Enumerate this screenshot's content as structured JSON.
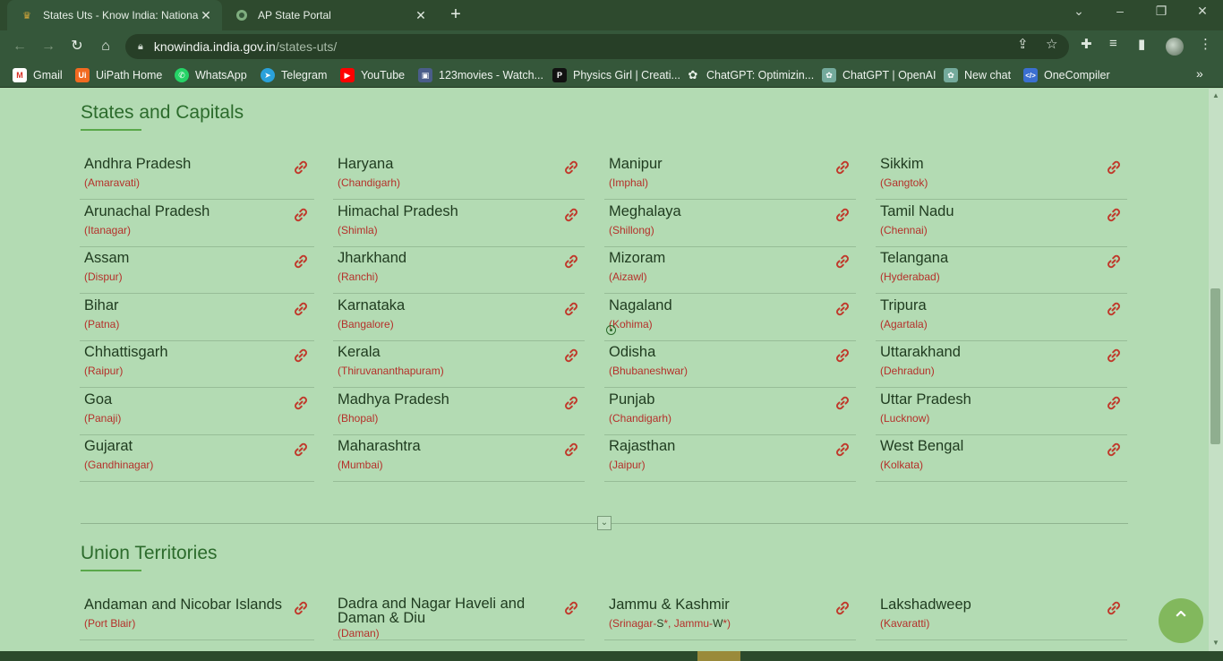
{
  "browser": {
    "tabs": [
      {
        "title": "States Uts - Know India: National",
        "active": true
      },
      {
        "title": "AP State Portal",
        "active": false
      }
    ],
    "new_tab": "+",
    "url_host": "knowindia.india.gov.in",
    "url_path": "/states-uts/",
    "bookmarks": [
      {
        "label": "Gmail",
        "icon": "gmail-icon"
      },
      {
        "label": "UiPath Home",
        "icon": "uipath-icon"
      },
      {
        "label": "WhatsApp",
        "icon": "whatsapp-icon"
      },
      {
        "label": "Telegram",
        "icon": "telegram-icon"
      },
      {
        "label": "YouTube",
        "icon": "youtube-icon"
      },
      {
        "label": "123movies - Watch...",
        "icon": "movies-icon"
      },
      {
        "label": "Physics Girl | Creati...",
        "icon": "patreon-icon"
      },
      {
        "label": "ChatGPT: Optimizin...",
        "icon": "openai-icon"
      },
      {
        "label": "ChatGPT | OpenAI",
        "icon": "openai-icon"
      },
      {
        "label": "New chat",
        "icon": "openai-icon"
      },
      {
        "label": "OneCompiler",
        "icon": "code-icon"
      }
    ]
  },
  "states": {
    "title": "States and Capitals",
    "columns": [
      [
        {
          "name": "Andhra Pradesh",
          "capital": "(Amaravati)"
        },
        {
          "name": "Arunachal Pradesh",
          "capital": "(Itanagar)"
        },
        {
          "name": "Assam",
          "capital": "(Dispur)"
        },
        {
          "name": "Bihar",
          "capital": "(Patna)"
        },
        {
          "name": "Chhattisgarh",
          "capital": "(Raipur)"
        },
        {
          "name": "Goa",
          "capital": "(Panaji)"
        },
        {
          "name": "Gujarat",
          "capital": "(Gandhinagar)"
        }
      ],
      [
        {
          "name": "Haryana",
          "capital": "(Chandigarh)"
        },
        {
          "name": "Himachal Pradesh",
          "capital": "(Shimla)"
        },
        {
          "name": "Jharkhand",
          "capital": "(Ranchi)"
        },
        {
          "name": "Karnataka",
          "capital": "(Bangalore)"
        },
        {
          "name": "Kerala",
          "capital": "(Thiruvananthapuram)"
        },
        {
          "name": "Madhya Pradesh",
          "capital": "(Bhopal)"
        },
        {
          "name": "Maharashtra",
          "capital": "(Mumbai)"
        }
      ],
      [
        {
          "name": "Manipur",
          "capital": "(Imphal)"
        },
        {
          "name": "Meghalaya",
          "capital": "(Shillong)"
        },
        {
          "name": "Mizoram",
          "capital": "(Aizawl)"
        },
        {
          "name": "Nagaland",
          "capital": "(Kohima)"
        },
        {
          "name": "Odisha",
          "capital": "(Bhubaneshwar)"
        },
        {
          "name": "Punjab",
          "capital": "(Chandigarh)"
        },
        {
          "name": "Rajasthan",
          "capital": "(Jaipur)"
        }
      ],
      [
        {
          "name": "Sikkim",
          "capital": "(Gangtok)"
        },
        {
          "name": "Tamil Nadu",
          "capital": "(Chennai)"
        },
        {
          "name": "Telangana",
          "capital": "(Hyderabad)"
        },
        {
          "name": "Tripura",
          "capital": "(Agartala)"
        },
        {
          "name": "Uttarakhand",
          "capital": "(Dehradun)"
        },
        {
          "name": "Uttar Pradesh",
          "capital": "(Lucknow)"
        },
        {
          "name": "West Bengal",
          "capital": "(Kolkata)"
        }
      ]
    ]
  },
  "uts": {
    "title": "Union Territories",
    "items": [
      {
        "name": "Andaman and Nicobar Islands",
        "capital": "(Port Blair)"
      },
      {
        "name": "Dadra and Nagar Haveli and Daman & Diu",
        "capital": "(Daman)"
      },
      {
        "name": "Jammu & Kashmir",
        "capital_parts": [
          "(Srinagar-",
          "S",
          "*, ",
          "Jammu-",
          "W",
          "*)"
        ]
      },
      {
        "name": "Lakshadweep",
        "capital": "(Kavaratti)"
      }
    ]
  },
  "colors": {
    "page_bg": "#b3dbb3",
    "heading": "#2c6b2c",
    "state_name": "#1f3b1f",
    "capital": "#b5302a",
    "link_icon": "#c0392b"
  }
}
